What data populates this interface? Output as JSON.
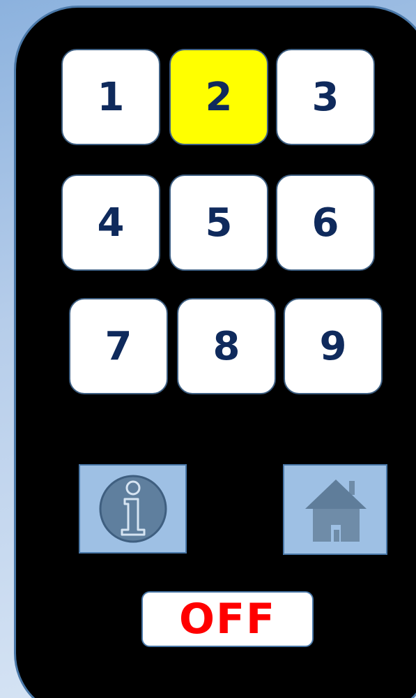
{
  "remote": {
    "keys": [
      {
        "label": "1",
        "selected": false
      },
      {
        "label": "2",
        "selected": true
      },
      {
        "label": "3",
        "selected": false
      },
      {
        "label": "4",
        "selected": false
      },
      {
        "label": "5",
        "selected": false
      },
      {
        "label": "6",
        "selected": false
      },
      {
        "label": "7",
        "selected": false
      },
      {
        "label": "8",
        "selected": false
      },
      {
        "label": "9",
        "selected": false
      }
    ],
    "info_icon": "info-icon",
    "home_icon": "home-icon",
    "off_label": "OFF"
  },
  "colors": {
    "body": "#000000",
    "key_face": "#ffffff",
    "key_selected": "#ffff00",
    "key_text": "#0f2a5c",
    "icon_button": "#9ec0e4",
    "off_text": "#ff0000"
  }
}
